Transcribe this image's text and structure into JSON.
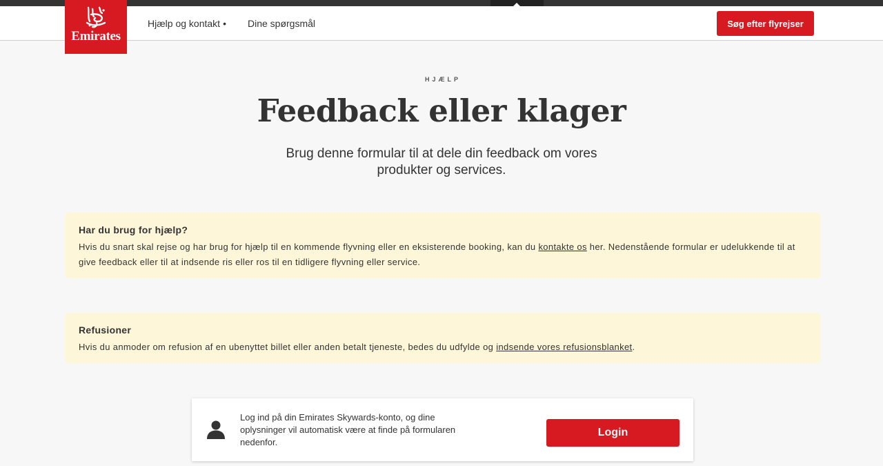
{
  "header": {
    "logo_text": "Emirates",
    "nav": {
      "help_contact": "Hjælp og kontakt",
      "help_contact_marker": "•",
      "your_questions": "Dine spørgsmål"
    },
    "search_flights_label": "Søg efter flyrejser"
  },
  "hero": {
    "eyebrow": "HJÆLP",
    "title": "Feedback eller klager",
    "subtitle": "Brug denne formular til at dele din feedback om vores produkter og services."
  },
  "notices": {
    "help": {
      "heading": "Har du brug for hjælp?",
      "text_before": "Hvis du snart skal rejse og har brug for hjælp til en kommende flyvning eller en eksisterende booking, kan du ",
      "link": "kontakte os",
      "text_after": " her. Nedenstående formular er udelukkende til at give feedback eller til at indsende ris eller ros til en tidligere flyvning eller service."
    },
    "refund": {
      "heading": "Refusioner",
      "text_before": "Hvis du anmoder om refusion af en ubenyttet billet eller anden betalt tjeneste, bedes du udfylde og ",
      "link": "indsende vores refusionsblanket",
      "text_after": "."
    }
  },
  "login_card": {
    "text": "Log ind på din Emirates Skywards-konto, og dine oplysninger vil automatisk være at finde på formularen nedenfor.",
    "button_label": "Login"
  },
  "colors": {
    "brand_red": "#d71921",
    "notice_bg": "#fdf6d8",
    "page_bg": "#f7f7f7"
  },
  "icons": {
    "logo_emblem": "emirates-calligraphy-icon",
    "user": "user-icon"
  }
}
